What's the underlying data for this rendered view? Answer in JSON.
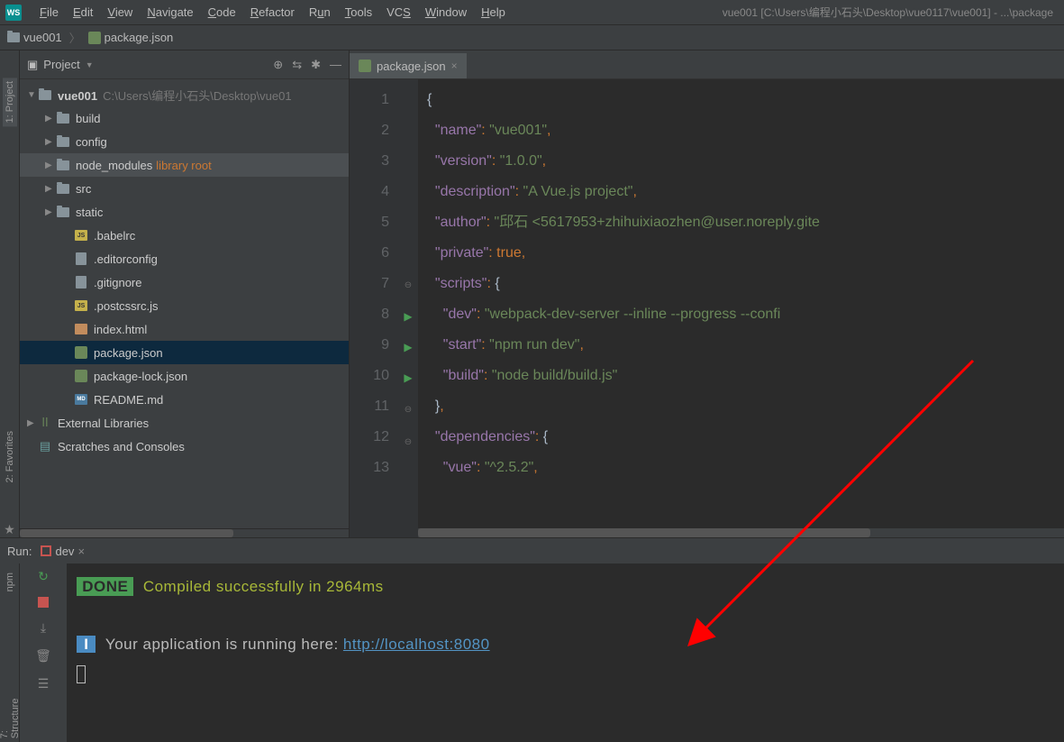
{
  "menu": {
    "file": "File",
    "edit": "Edit",
    "view": "View",
    "navigate": "Navigate",
    "code": "Code",
    "refactor": "Refactor",
    "run": "Run",
    "tools": "Tools",
    "vcs": "VCS",
    "window": "Window",
    "help": "Help"
  },
  "window_title": "vue001 [C:\\Users\\编程小石头\\Desktop\\vue0117\\vue001] - ...\\package",
  "breadcrumb": {
    "project": "vue001",
    "file": "package.json"
  },
  "project_panel": {
    "title": "Project",
    "root": "vue001",
    "root_path": "C:\\Users\\编程小石头\\Desktop\\vue01",
    "folders": [
      {
        "name": "build"
      },
      {
        "name": "config"
      },
      {
        "name": "node_modules",
        "note": "library root",
        "hl": true
      },
      {
        "name": "src"
      },
      {
        "name": "static"
      }
    ],
    "files": [
      {
        "name": ".babelrc",
        "icon": "js"
      },
      {
        "name": ".editorconfig",
        "icon": "file"
      },
      {
        "name": ".gitignore",
        "icon": "file"
      },
      {
        "name": ".postcssrc.js",
        "icon": "js"
      },
      {
        "name": "index.html",
        "icon": "html"
      },
      {
        "name": "package.json",
        "icon": "json",
        "sel": true
      },
      {
        "name": "package-lock.json",
        "icon": "json"
      },
      {
        "name": "README.md",
        "icon": "md"
      }
    ],
    "external": "External Libraries",
    "scratches": "Scratches and Consoles"
  },
  "editor": {
    "tab": "package.json",
    "lines": [
      {
        "n": 1,
        "html": "<span class='tok-brace'>{</span>"
      },
      {
        "n": 2,
        "html": "  <span class='tok-key'>\"name\"</span><span class='tok-punc'>: </span><span class='tok-str'>\"vue001\"</span><span class='tok-punc'>,</span>"
      },
      {
        "n": 3,
        "html": "  <span class='tok-key'>\"version\"</span><span class='tok-punc'>: </span><span class='tok-str'>\"1.0.0\"</span><span class='tok-punc'>,</span>"
      },
      {
        "n": 4,
        "html": "  <span class='tok-key'>\"description\"</span><span class='tok-punc'>: </span><span class='tok-str'>\"A Vue.js project\"</span><span class='tok-punc'>,</span>"
      },
      {
        "n": 5,
        "html": "  <span class='tok-key'>\"author\"</span><span class='tok-punc'>: </span><span class='tok-str'>\"邱石 &lt;5617953+zhihuixiaozhen@user.noreply.gite</span>"
      },
      {
        "n": 6,
        "html": "  <span class='tok-key'>\"private\"</span><span class='tok-punc'>: </span><span class='tok-bool'>true</span><span class='tok-punc'>,</span>"
      },
      {
        "n": 7,
        "html": "  <span class='tok-key'>\"scripts\"</span><span class='tok-punc'>: </span><span class='tok-brace'>{</span>",
        "fold": true
      },
      {
        "n": 8,
        "html": "    <span class='tok-key'>\"dev\"</span><span class='tok-punc'>: </span><span class='tok-str'>\"webpack-dev-server --inline --progress --confi</span>",
        "run": true
      },
      {
        "n": 9,
        "html": "    <span class='tok-key'>\"start\"</span><span class='tok-punc'>: </span><span class='tok-str'>\"npm run dev\"</span><span class='tok-punc'>,</span>",
        "run": true
      },
      {
        "n": 10,
        "html": "    <span class='tok-key'>\"build\"</span><span class='tok-punc'>: </span><span class='tok-str'>\"node build/build.js\"</span>",
        "run": true
      },
      {
        "n": 11,
        "html": "  <span class='tok-brace'>}</span><span class='tok-punc'>,</span>",
        "fold": true
      },
      {
        "n": 12,
        "html": "  <span class='tok-key'>\"dependencies\"</span><span class='tok-punc'>: </span><span class='tok-brace'>{</span>",
        "fold": true
      },
      {
        "n": 13,
        "html": "    <span class='tok-key'>\"vue\"</span><span class='tok-punc'>: </span><span class='tok-str'>\"^2.5.2\"</span><span class='tok-punc'>,</span>"
      }
    ]
  },
  "run": {
    "label": "Run:",
    "config": "dev",
    "done": "DONE",
    "compiled": "Compiled successfully in 2964ms",
    "info_badge": "I",
    "running_text": "Your application is running here: ",
    "url": "http://localhost:8080"
  },
  "side_tabs": {
    "project": "1: Project",
    "favorites": "2: Favorites",
    "npm": "npm",
    "structure": "7: Structure"
  }
}
